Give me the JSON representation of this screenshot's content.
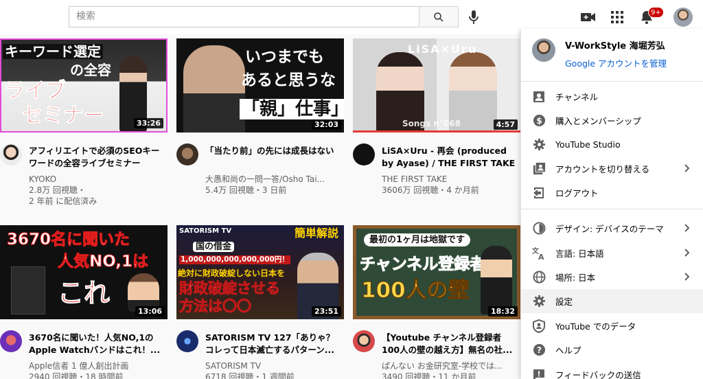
{
  "search": {
    "placeholder": "検索"
  },
  "header": {
    "notification_count": "9+"
  },
  "videos": [
    {
      "title": "アフィリエイトで必須のSEOキーワードの全容ライブセミナー",
      "channel": "KYOKO",
      "views": "2.8万 回視聴・",
      "age": "2 年前 に配信済み",
      "duration": "33:26",
      "overlay": [
        "キーワード選定",
        "の全容",
        "ライブ",
        "セミナー"
      ]
    },
    {
      "title": "「当たり前」の先には成長はない",
      "channel": "大愚和尚の一問一答/Osho Tai...",
      "views": "5.4万 回視聴・3 日前",
      "age": "",
      "duration": "32:03",
      "overlay": [
        "いつまでも",
        "あると思うな",
        "「親」仕事」"
      ]
    },
    {
      "title": "LiSA×Uru - 再会 (produced by Ayase) / THE FIRST TAKE",
      "channel": "THE FIRST TAKE",
      "views": "3606万 回視聴・4 か月前",
      "age": "",
      "duration": "4:57",
      "overlay": [
        "LiSA×Uru",
        "Songs n°068"
      ]
    },
    {
      "title": "3670名に聞いた！人気NO,1のApple Watchバンドはこれ！...",
      "channel": "Apple信者 1 億人創出計画",
      "views": "2940 回視聴・18 時間前",
      "age": "",
      "duration": "13:06",
      "overlay": [
        "3670名に聞いた",
        "人気NO,1は",
        "これ"
      ]
    },
    {
      "title": "SATORISM TV 127「ありゃ？コレって日本滅亡するパターン...",
      "channel": "SATORISM TV",
      "views": "6718 回視聴・1 週間前",
      "age": "",
      "duration": "23:51",
      "overlay": [
        "SATORISM TV",
        "簡単解説",
        "国の借金",
        "1,000,000,000,000,000円！",
        "絶対に財政破綻しない日本を",
        "財政破綻させる",
        "方法は〇〇"
      ]
    },
    {
      "title": "【Youtube チャンネル登録者100人の壁の越え方】無名の社...",
      "channel": "ぱんない お金研究室-学校では...",
      "views": "3490 回視聴・11 か月前",
      "age": "",
      "duration": "18:32",
      "overlay": [
        "最初の1ヶ月は地獄です",
        "チャンネル登録者",
        "100人の壁"
      ]
    }
  ],
  "menu": {
    "account_name": "V-WorkStyle 海堀芳弘",
    "manage_link": "Google アカウントを管理",
    "items": [
      {
        "label": "チャンネル",
        "icon": "person-box-icon"
      },
      {
        "label": "購入とメンバーシップ",
        "icon": "dollar-icon"
      },
      {
        "label": "YouTube Studio",
        "icon": "gear-icon"
      },
      {
        "label": "アカウントを切り替える",
        "icon": "switch-account-icon"
      },
      {
        "label": "ログアウト",
        "icon": "logout-icon"
      },
      {
        "label": "デザイン: デバイスのテーマ",
        "icon": "theme-icon"
      },
      {
        "label": "言語: 日本語",
        "icon": "translate-icon"
      },
      {
        "label": "場所: 日本",
        "icon": "globe-icon"
      },
      {
        "label": "設定",
        "icon": "gear-icon"
      },
      {
        "label": "YouTube でのデータ",
        "icon": "shield-person-icon"
      },
      {
        "label": "ヘルプ",
        "icon": "help-icon"
      },
      {
        "label": "フィードバックの送信",
        "icon": "feedback-icon"
      }
    ]
  },
  "colors": {
    "accent_link": "#065fd4",
    "badge": "#cc0000",
    "lisa_bar": "#e53935"
  }
}
